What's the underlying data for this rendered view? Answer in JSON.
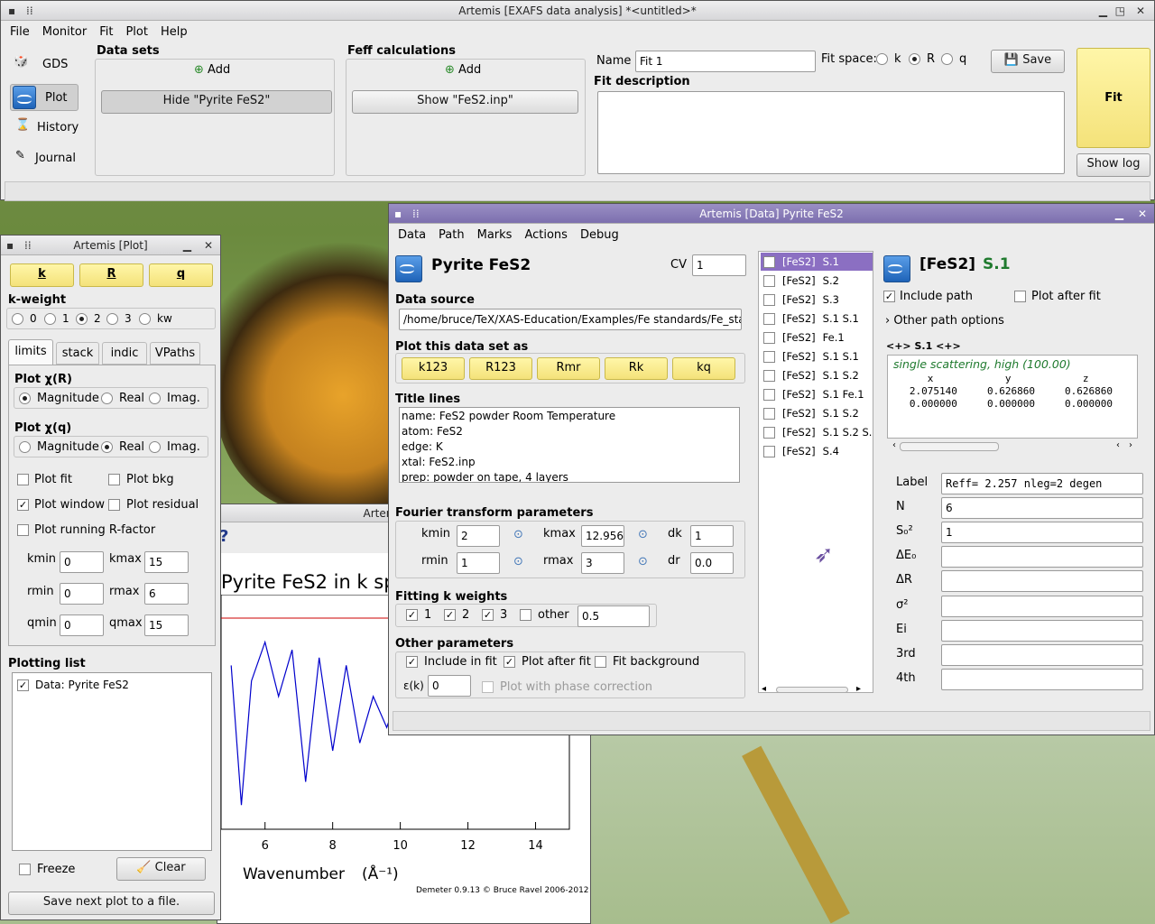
{
  "main": {
    "title": "Artemis [EXAFS data analysis] *<untitled>*",
    "menu": [
      "File",
      "Monitor",
      "Fit",
      "Plot",
      "Help"
    ],
    "side": [
      "GDS",
      "Plot",
      "History",
      "Journal"
    ],
    "datasets_title": "Data sets",
    "add": "Add",
    "hide_btn": "Hide \"Pyrite FeS2\"",
    "feff_title": "Feff calculations",
    "show_btn": "Show \"FeS2.inp\"",
    "name_label": "Name",
    "name_value": "Fit 1",
    "fitspace": "Fit space:",
    "k": "k",
    "R": "R",
    "q": "q",
    "save": "Save",
    "fitdesc": "Fit description",
    "fit": "Fit",
    "showlog": "Show log"
  },
  "plotwin": {
    "title": "Artemis [Plot]",
    "k": "k",
    "R": "R",
    "q": "q",
    "kweight": "k-weight",
    "kw": [
      "0",
      "1",
      "2",
      "3",
      "kw"
    ],
    "tabs": [
      "limits",
      "stack",
      "indic",
      "VPaths"
    ],
    "plotR": "Plot χ(R)",
    "plotq": "Plot χ(q)",
    "mag": "Magnitude",
    "real": "Real",
    "imag": "Imag.",
    "plotfit": "Plot fit",
    "plotbkg": "Plot bkg",
    "plotwindow": "Plot window",
    "plotresid": "Plot residual",
    "plotrf": "Plot running R-factor",
    "kmin": "kmin",
    "kmin_v": "0",
    "kmax": "kmax",
    "kmax_v": "15",
    "rmin": "rmin",
    "rmin_v": "0",
    "rmax": "rmax",
    "rmax_v": "6",
    "qmin": "qmin",
    "qmin_v": "0",
    "qmax": "qmax",
    "qmax_v": "15",
    "plotlist": "Plotting list",
    "plotitem": "Data: Pyrite FeS2",
    "freeze": "Freeze",
    "clear": "Clear",
    "savenext": "Save next plot to a file."
  },
  "plot1": {
    "title": "Artemis[Plot.1]",
    "chart_title": "Pyrite FeS2 in k spa",
    "xlabel": "Wavenumber",
    "xunit": "(Å⁻¹)",
    "credit": "Demeter 0.9.13 © Bruce Ravel 2006-2012",
    "ticks": [
      "6",
      "8",
      "10",
      "12",
      "14"
    ]
  },
  "chart_data": {
    "type": "line",
    "x": [
      5.0,
      5.3,
      5.6,
      6.0,
      6.4,
      6.8,
      7.2,
      7.6,
      8.0,
      8.4,
      8.8,
      9.2,
      9.6,
      10.0,
      10.4,
      10.8,
      11.2,
      11.6,
      12.0
    ],
    "values": [
      0.6,
      -1.2,
      0.4,
      0.9,
      0.2,
      0.8,
      -0.9,
      0.7,
      -0.5,
      0.6,
      -0.4,
      0.2,
      -0.2,
      0.3,
      0.1,
      0.2,
      0.0,
      0.1,
      0.0
    ],
    "xlabel": "Wavenumber",
    "xticks": [
      6,
      8,
      10,
      12,
      14
    ]
  },
  "data": {
    "title": "Artemis [Data] Pyrite FeS2",
    "menu": [
      "Data",
      "Path",
      "Marks",
      "Actions",
      "Debug"
    ],
    "name": "Pyrite FeS2",
    "cv": "CV",
    "cv_v": "1",
    "source_lbl": "Data source",
    "source": "/home/bruce/TeX/XAS-Education/Examples/Fe standards/Fe_sta",
    "plotas": "Plot this data set as",
    "plotbtns": [
      "k123",
      "R123",
      "Rmr",
      "Rk",
      "kq"
    ],
    "titles_lbl": "Title lines",
    "titles": [
      "name: FeS2 powder  Room Temperature",
      "atom: FeS2",
      "edge: K",
      "xtal: FeS2.inp",
      "prep: powder on tape, 4 layers"
    ],
    "ft": "Fourier transform parameters",
    "kmin": "kmin",
    "kmin_v": "2",
    "kmax": "kmax",
    "kmax_v": "12.956",
    "dk": "dk",
    "dk_v": "1",
    "rmin": "rmin",
    "rmin_v": "1",
    "rmax": "rmax",
    "rmax_v": "3",
    "dr": "dr",
    "dr_v": "0.0",
    "fkw": "Fitting k weights",
    "w1": "1",
    "w2": "2",
    "w3": "3",
    "other": "other",
    "other_v": "0.5",
    "op": "Other parameters",
    "incfit": "Include in fit",
    "plotafter": "Plot after fit",
    "fitbkg": "Fit background",
    "eps": "ε(k)",
    "eps_v": "0",
    "phase": "Plot with phase correction",
    "paths": [
      [
        "[FeS2]",
        "S.1"
      ],
      [
        "[FeS2]",
        "S.2"
      ],
      [
        "[FeS2]",
        "S.3"
      ],
      [
        "[FeS2]",
        "S.1 S.1"
      ],
      [
        "[FeS2]",
        "Fe.1"
      ],
      [
        "[FeS2]",
        "S.1 S.1"
      ],
      [
        "[FeS2]",
        "S.1 S.2"
      ],
      [
        "[FeS2]",
        "S.1 Fe.1"
      ],
      [
        "[FeS2]",
        "S.1 S.2"
      ],
      [
        "[FeS2]",
        "S.1 S.2 S."
      ],
      [
        "[FeS2]",
        "S.4"
      ]
    ],
    "pname": "[FeS2]",
    "pid": "S.1",
    "incpath": "Include path",
    "plotafterfit": "Plot after fit",
    "otheropts": "Other path options",
    "nav": "<+> S.1  <+>",
    "sstext": "single scattering, high (100.00)",
    "hdr": "      x            y            z        ipo",
    "r1": "   2.075140     0.626860     0.626860",
    "r2": "   0.000000     0.000000     0.000000",
    "params": [
      [
        "Label",
        "Reff=  2.257   nleg=2   degen"
      ],
      [
        "N",
        "6"
      ],
      [
        "S₀²",
        "1"
      ],
      [
        "ΔE₀",
        ""
      ],
      [
        "ΔR",
        ""
      ],
      [
        "σ²",
        ""
      ],
      [
        "Ei",
        ""
      ],
      [
        "3rd",
        ""
      ],
      [
        "4th",
        ""
      ]
    ]
  }
}
